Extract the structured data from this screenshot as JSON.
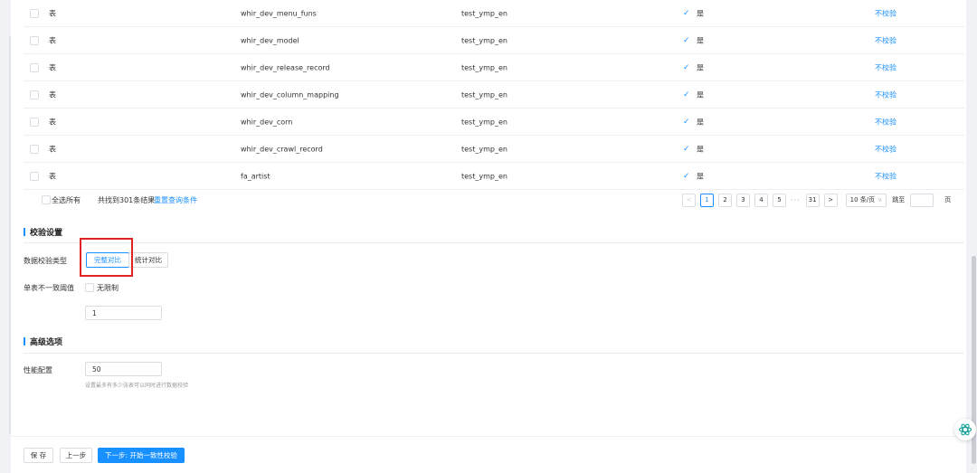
{
  "table": {
    "rows": [
      {
        "type": "表",
        "name": "whir_dev_menu_funs",
        "db": "test_ymp_en",
        "status": "是",
        "action": "不校验"
      },
      {
        "type": "表",
        "name": "whir_dev_model",
        "db": "test_ymp_en",
        "status": "是",
        "action": "不校验"
      },
      {
        "type": "表",
        "name": "whir_dev_release_record",
        "db": "test_ymp_en",
        "status": "是",
        "action": "不校验"
      },
      {
        "type": "表",
        "name": "whir_dev_column_mapping",
        "db": "test_ymp_en",
        "status": "是",
        "action": "不校验"
      },
      {
        "type": "表",
        "name": "whir_dev_corn",
        "db": "test_ymp_en",
        "status": "是",
        "action": "不校验"
      },
      {
        "type": "表",
        "name": "whir_dev_crawl_record",
        "db": "test_ymp_en",
        "status": "是",
        "action": "不校验"
      },
      {
        "type": "表",
        "name": "fa_artist",
        "db": "test_ymp_en",
        "status": "是",
        "action": "不校验"
      }
    ],
    "check_glyph": "✓"
  },
  "footer": {
    "select_all": "全选所有",
    "found_text": "共找到301条结果",
    "reset_link": "重置查询条件"
  },
  "pagination": {
    "prev": "<",
    "pages": [
      "1",
      "2",
      "3",
      "4",
      "5"
    ],
    "active_page": "1",
    "ellipsis": "···",
    "last": "31",
    "next": ">",
    "page_size": "10 条/页",
    "page_size_caret": "∨",
    "jump_label": "跳至",
    "page_unit": "页"
  },
  "validation": {
    "section_title": "校验设置",
    "type_label": "数据校验类型",
    "type_options": [
      "完整对比",
      "统计对比"
    ],
    "selected_type": "完整对比",
    "threshold_label": "单表不一致阈值",
    "unlimited_label": "无限制",
    "threshold_value": "1"
  },
  "advanced": {
    "section_title": "高级选项",
    "perf_label": "性能配置",
    "perf_value": "50",
    "perf_hint": "设置最多有多少张表可以同时进行数据校验"
  },
  "actions": {
    "save": "保 存",
    "prev": "上一步",
    "next": "下一步: 开始一致性校验"
  },
  "colors": {
    "primary": "#1890ff",
    "highlight": "#e02424"
  }
}
